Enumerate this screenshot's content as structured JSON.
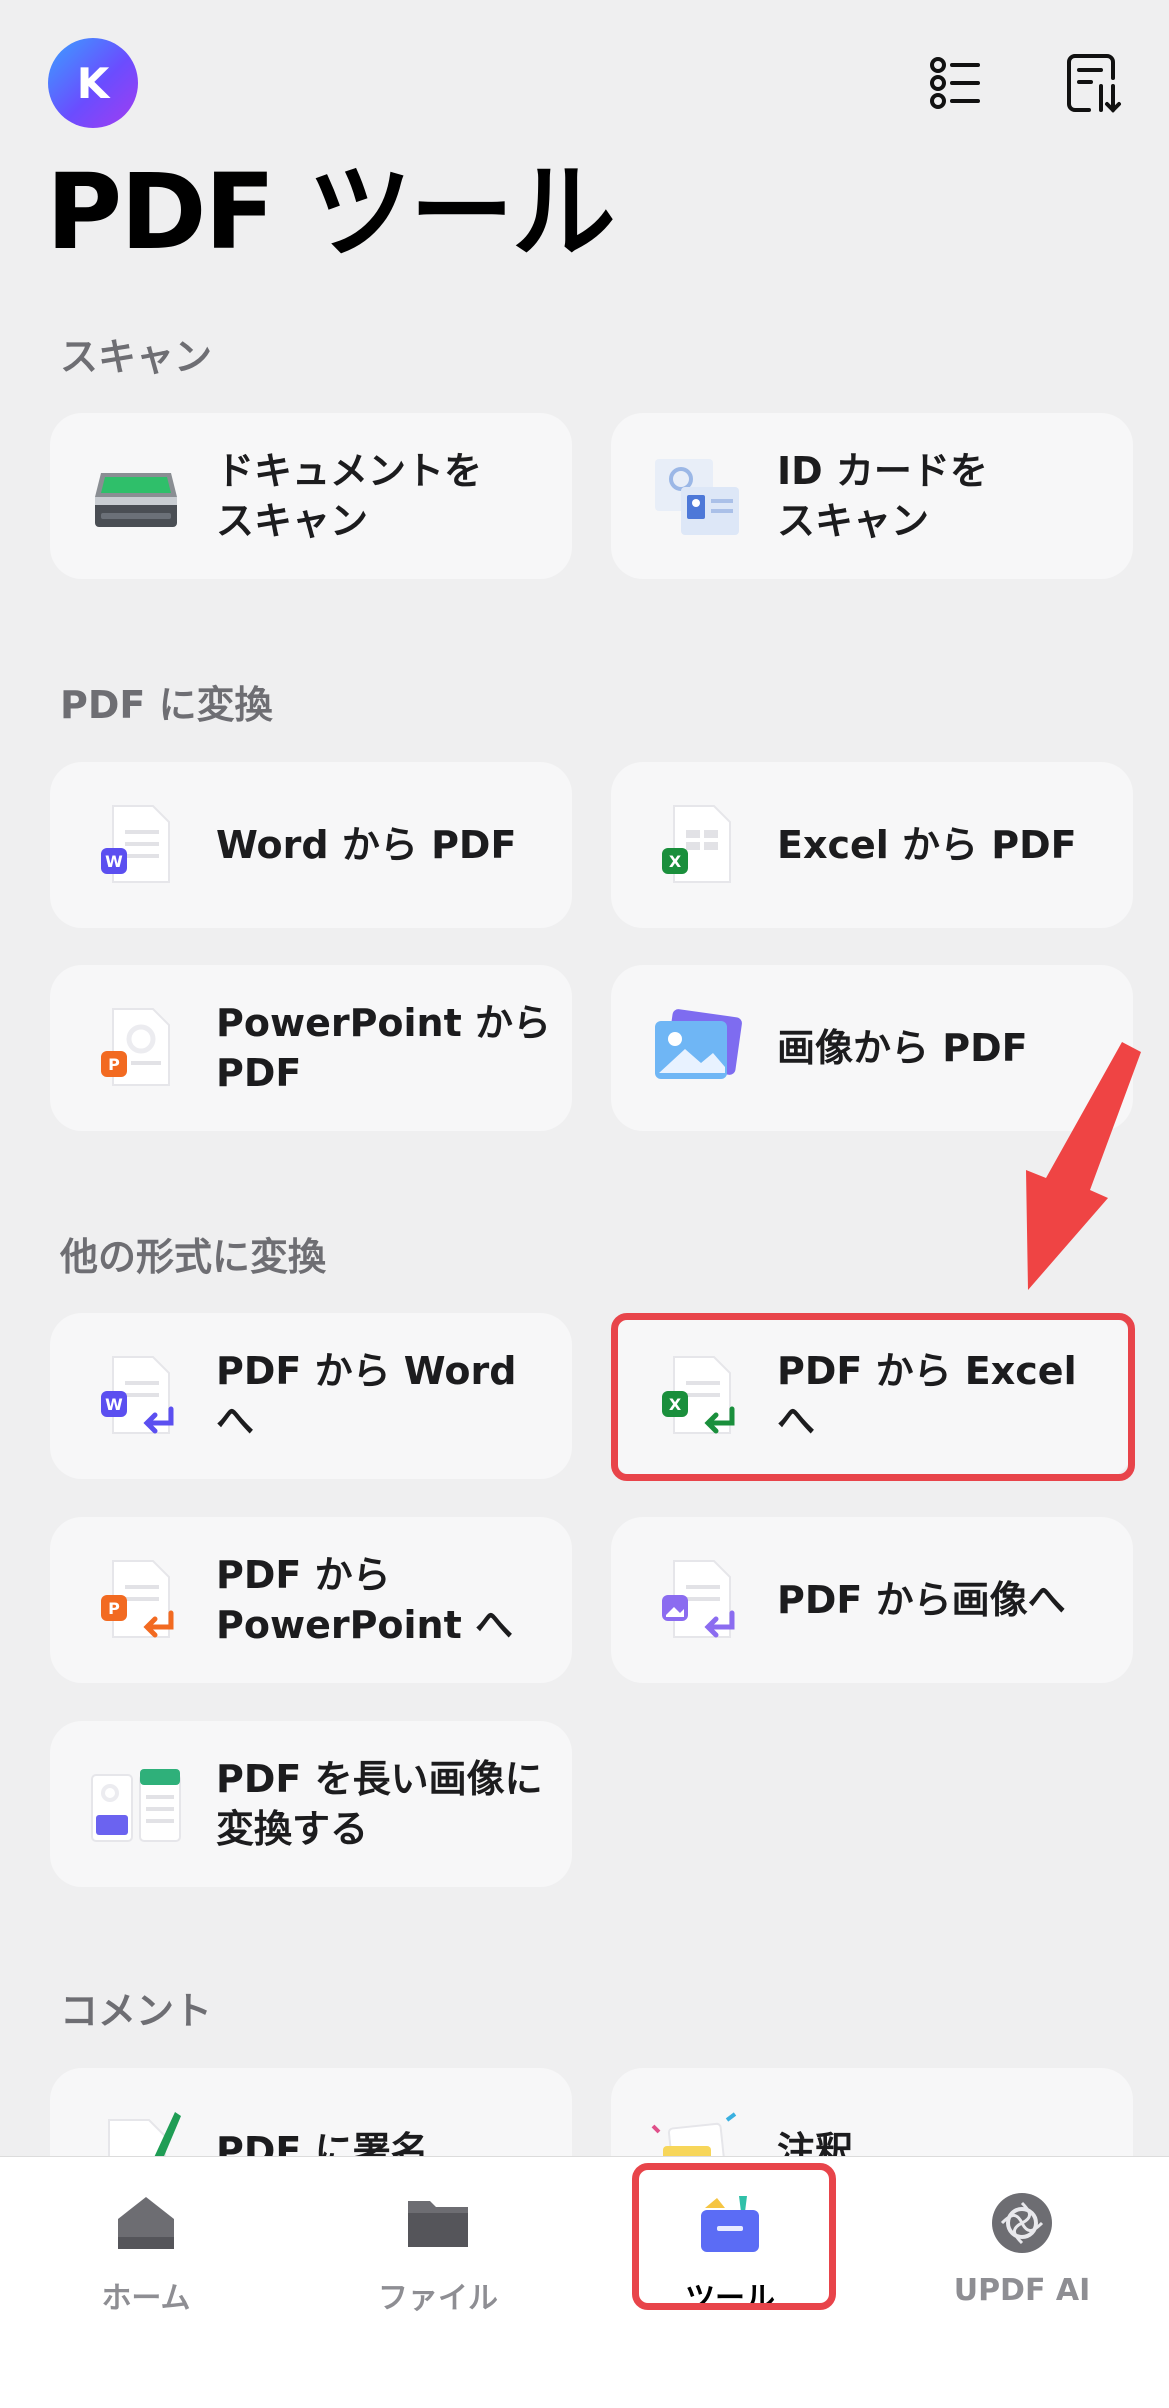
{
  "header": {
    "avatar_initial": "K",
    "title": "PDF ツール"
  },
  "sections": {
    "scan": {
      "title": "スキャン",
      "items": [
        "ドキュメントを\nスキャン",
        "ID カードを\nスキャン"
      ]
    },
    "to_pdf": {
      "title": "PDF に変換",
      "items": [
        "Word から PDF",
        "Excel から PDF",
        "PowerPoint から\nPDF",
        "画像から PDF"
      ]
    },
    "from_pdf": {
      "title": "他の形式に変換",
      "items": [
        "PDF から Word へ",
        "PDF から Excel へ",
        "PDF から\nPowerPoint へ",
        "PDF から画像へ",
        "PDF を長い画像に\n変換する"
      ]
    },
    "comment": {
      "title": "コメント",
      "items": [
        "PDF に署名",
        "注釈"
      ]
    }
  },
  "tabbar": {
    "items": [
      "ホーム",
      "ファイル",
      "ツール",
      "UPDF AI"
    ],
    "active": "ツール"
  },
  "colors": {
    "highlight": "#e8444a",
    "accent": "#6a4dff"
  }
}
